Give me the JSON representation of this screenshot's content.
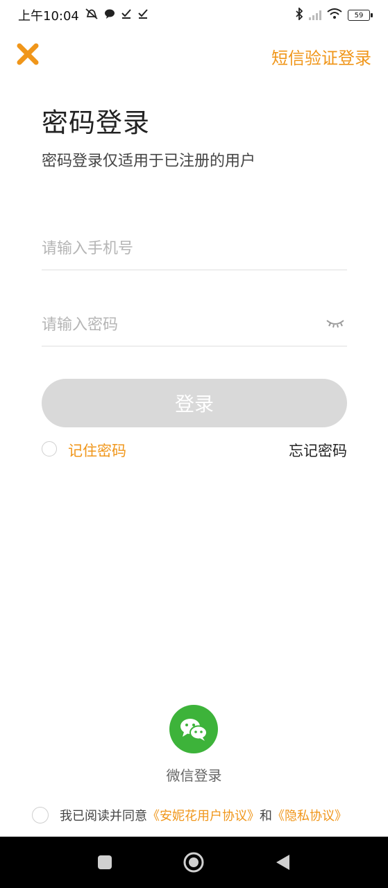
{
  "status_bar": {
    "time": "上午10:04",
    "battery": "59",
    "left_icons": [
      "mute-icon",
      "chat-bubble-icon",
      "check-icon",
      "check-icon"
    ],
    "right_icons": [
      "bluetooth-icon",
      "signal-icon",
      "wifi-icon",
      "battery-icon"
    ]
  },
  "header": {
    "close_icon": "close-icon",
    "sms_login_label": "短信验证登录"
  },
  "page": {
    "title": "密码登录",
    "subtitle": "密码登录仅适用于已注册的用户"
  },
  "form": {
    "phone_placeholder": "请输入手机号",
    "phone_value": "",
    "password_placeholder": "请输入密码",
    "password_value": "",
    "password_toggle_icon": "eye-closed-icon",
    "login_label": "登录",
    "remember_label": "记住密码",
    "remember_checked": false,
    "forgot_label": "忘记密码"
  },
  "social": {
    "wechat_icon": "wechat-icon",
    "wechat_label": "微信登录"
  },
  "agreement": {
    "checked": false,
    "prefix": "我已阅读并同意",
    "user_agreement": "《安妮花用户协议》",
    "and": "和",
    "privacy": "《隐私协议》"
  },
  "nav": {
    "icons": [
      "square-icon",
      "home-circle-icon",
      "back-triangle-icon"
    ]
  },
  "colors": {
    "accent": "#f0961a",
    "button_disabled": "#d9d9d9",
    "wechat_green": "#3db33a",
    "divider": "#eeeeee"
  }
}
